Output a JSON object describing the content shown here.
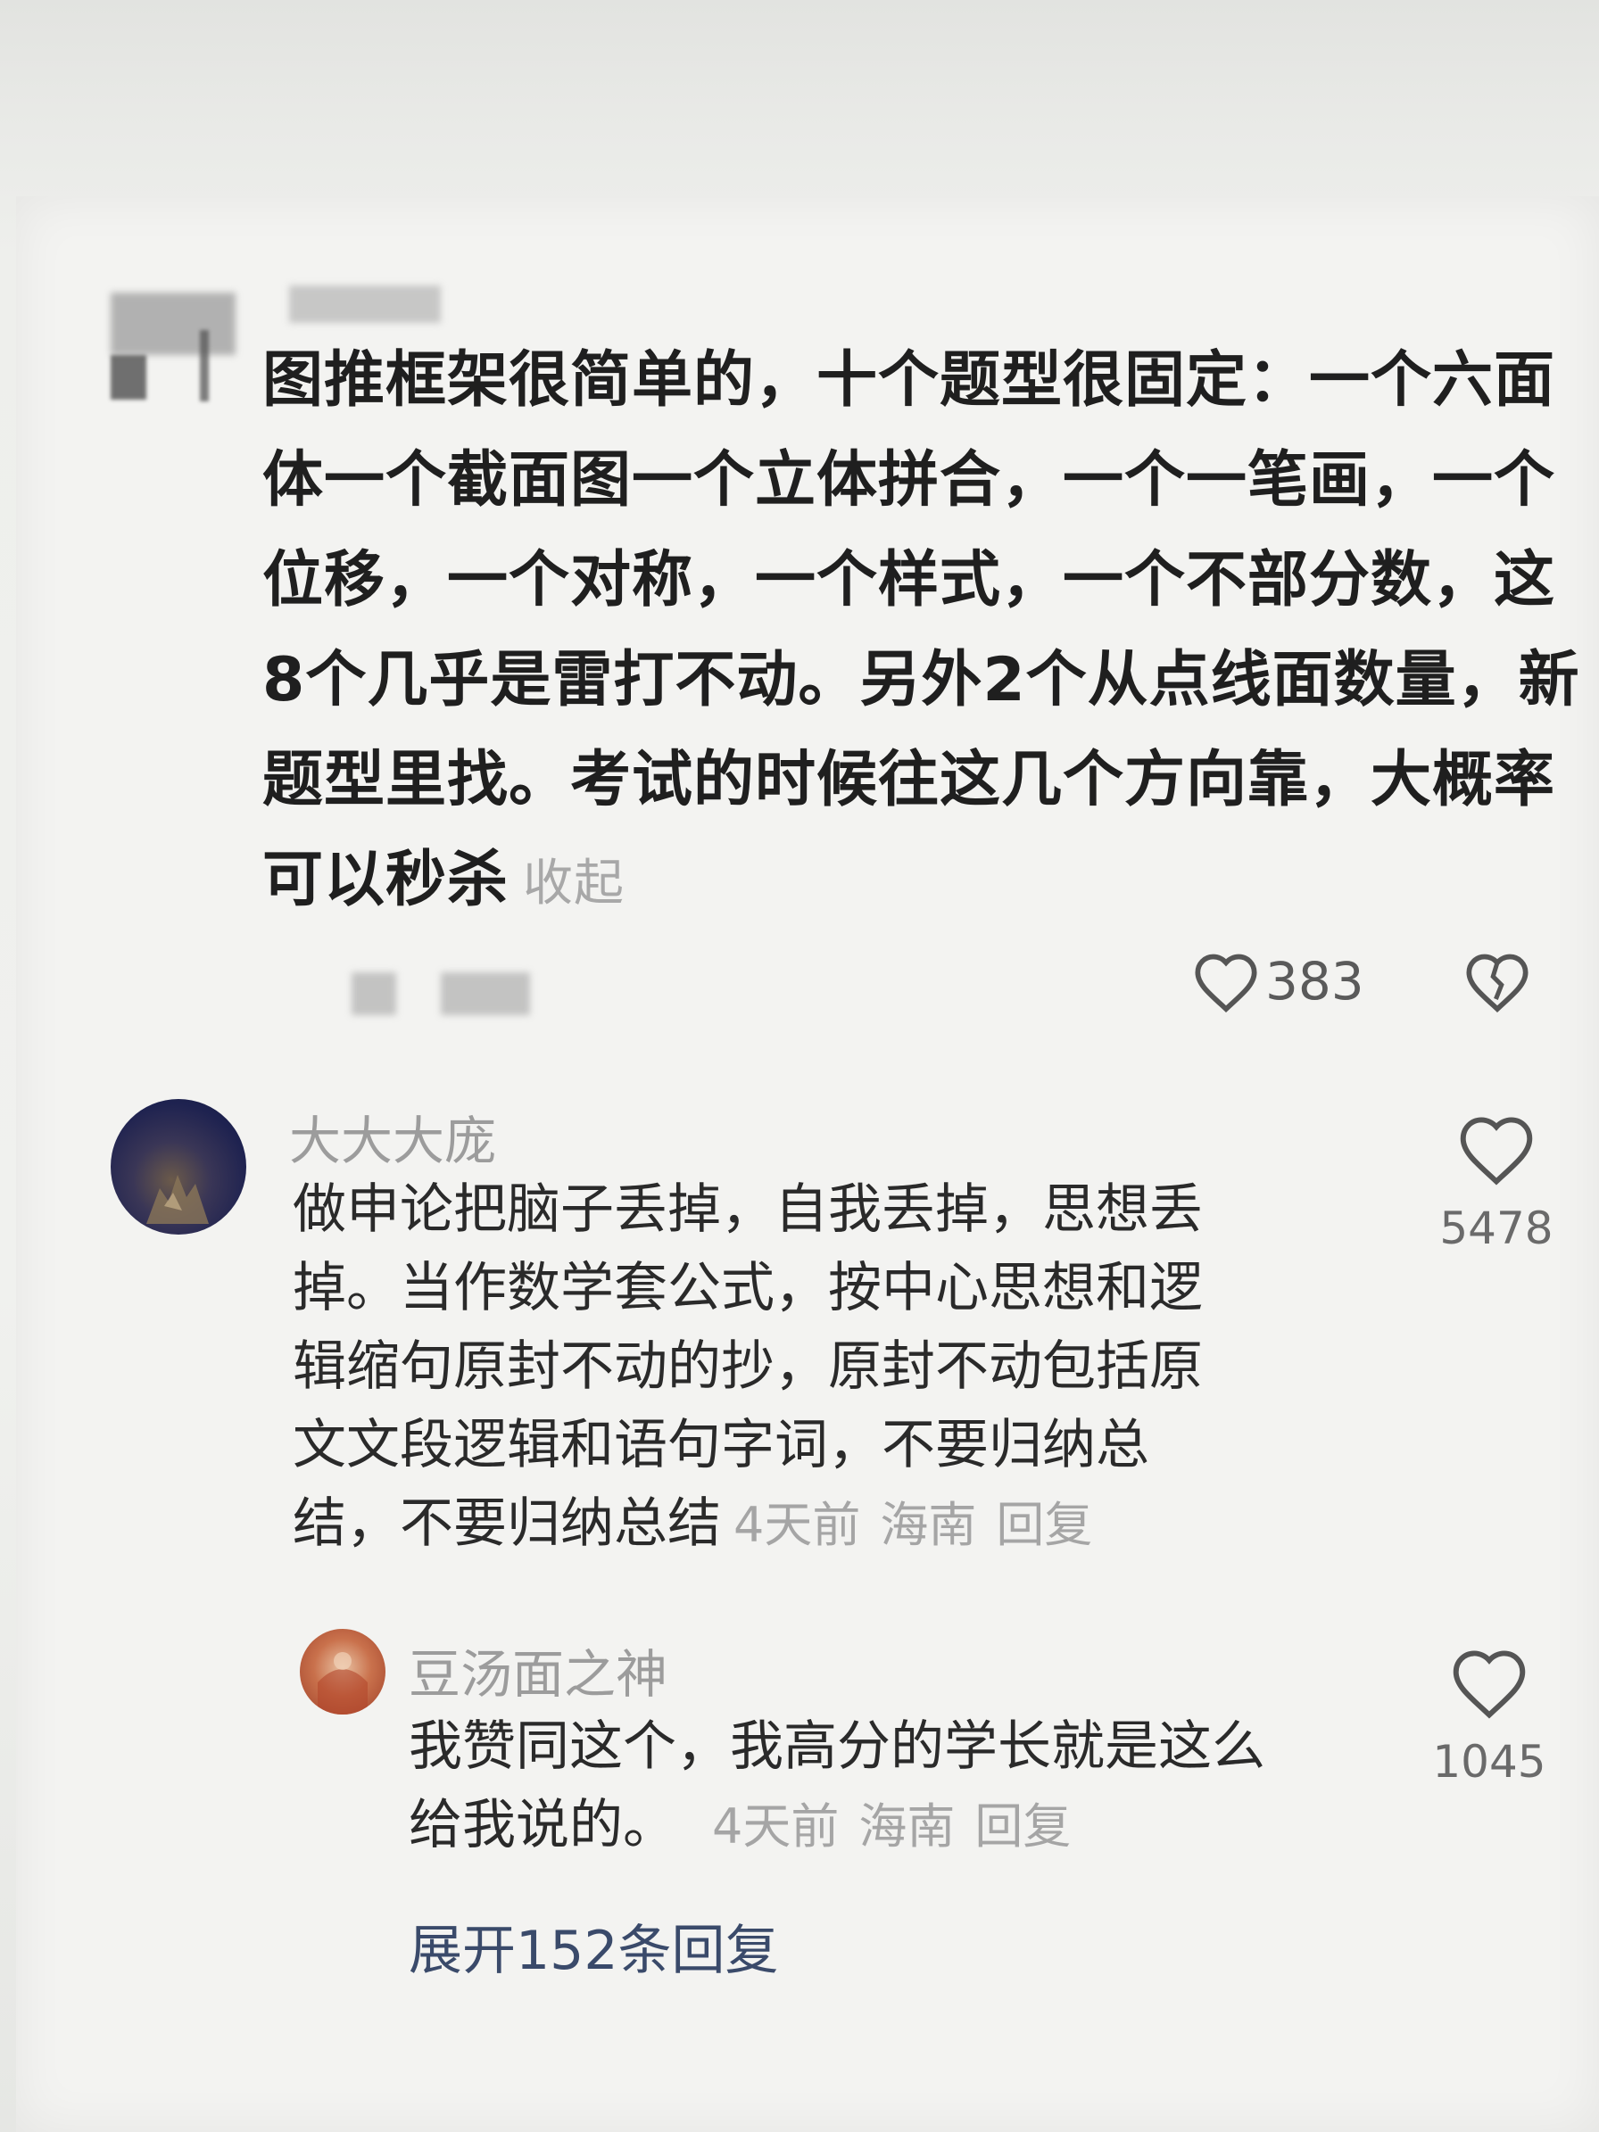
{
  "post": {
    "lines": [
      "图推框架很简单的，十个题型很固定：一个六面",
      "体一个截面图一个立体拼合，一个一笔画，一个",
      "位移，一个对称，一个样式，一个不部分数，这",
      "8个几乎是雷打不动。另外2个从点线面数量，新",
      "题型里找。考试的时候往这几个方向靠，大概率",
      "可以秒杀"
    ],
    "collapse_label": "收起",
    "like_count": "383",
    "like_icon": "heart-outline-icon",
    "dislike_icon": "broken-heart-icon"
  },
  "comments": [
    {
      "username": "大大大庞",
      "lines": [
        "做申论把脑子丢掉，自我丢掉，思想丢",
        "掉。当作数学套公式，按中心思想和逻",
        "辑缩句原封不动的抄，原封不动包括原",
        "文文段逻辑和语句字词，不要归纳总",
        "结，不要归纳总结"
      ],
      "time": "4天前",
      "location": "海南",
      "reply_label": "回复",
      "like_count": "5478",
      "avatar_color": "#2b2f5a"
    },
    {
      "username": "豆汤面之神",
      "lines": [
        "我赞同这个，我高分的学长就是这么",
        "给我说的。"
      ],
      "time": "4天前",
      "location": "海南",
      "reply_label": "回复",
      "like_count": "1045",
      "avatar_color": "#b4593a"
    }
  ],
  "expand_label": "展开152条回复"
}
